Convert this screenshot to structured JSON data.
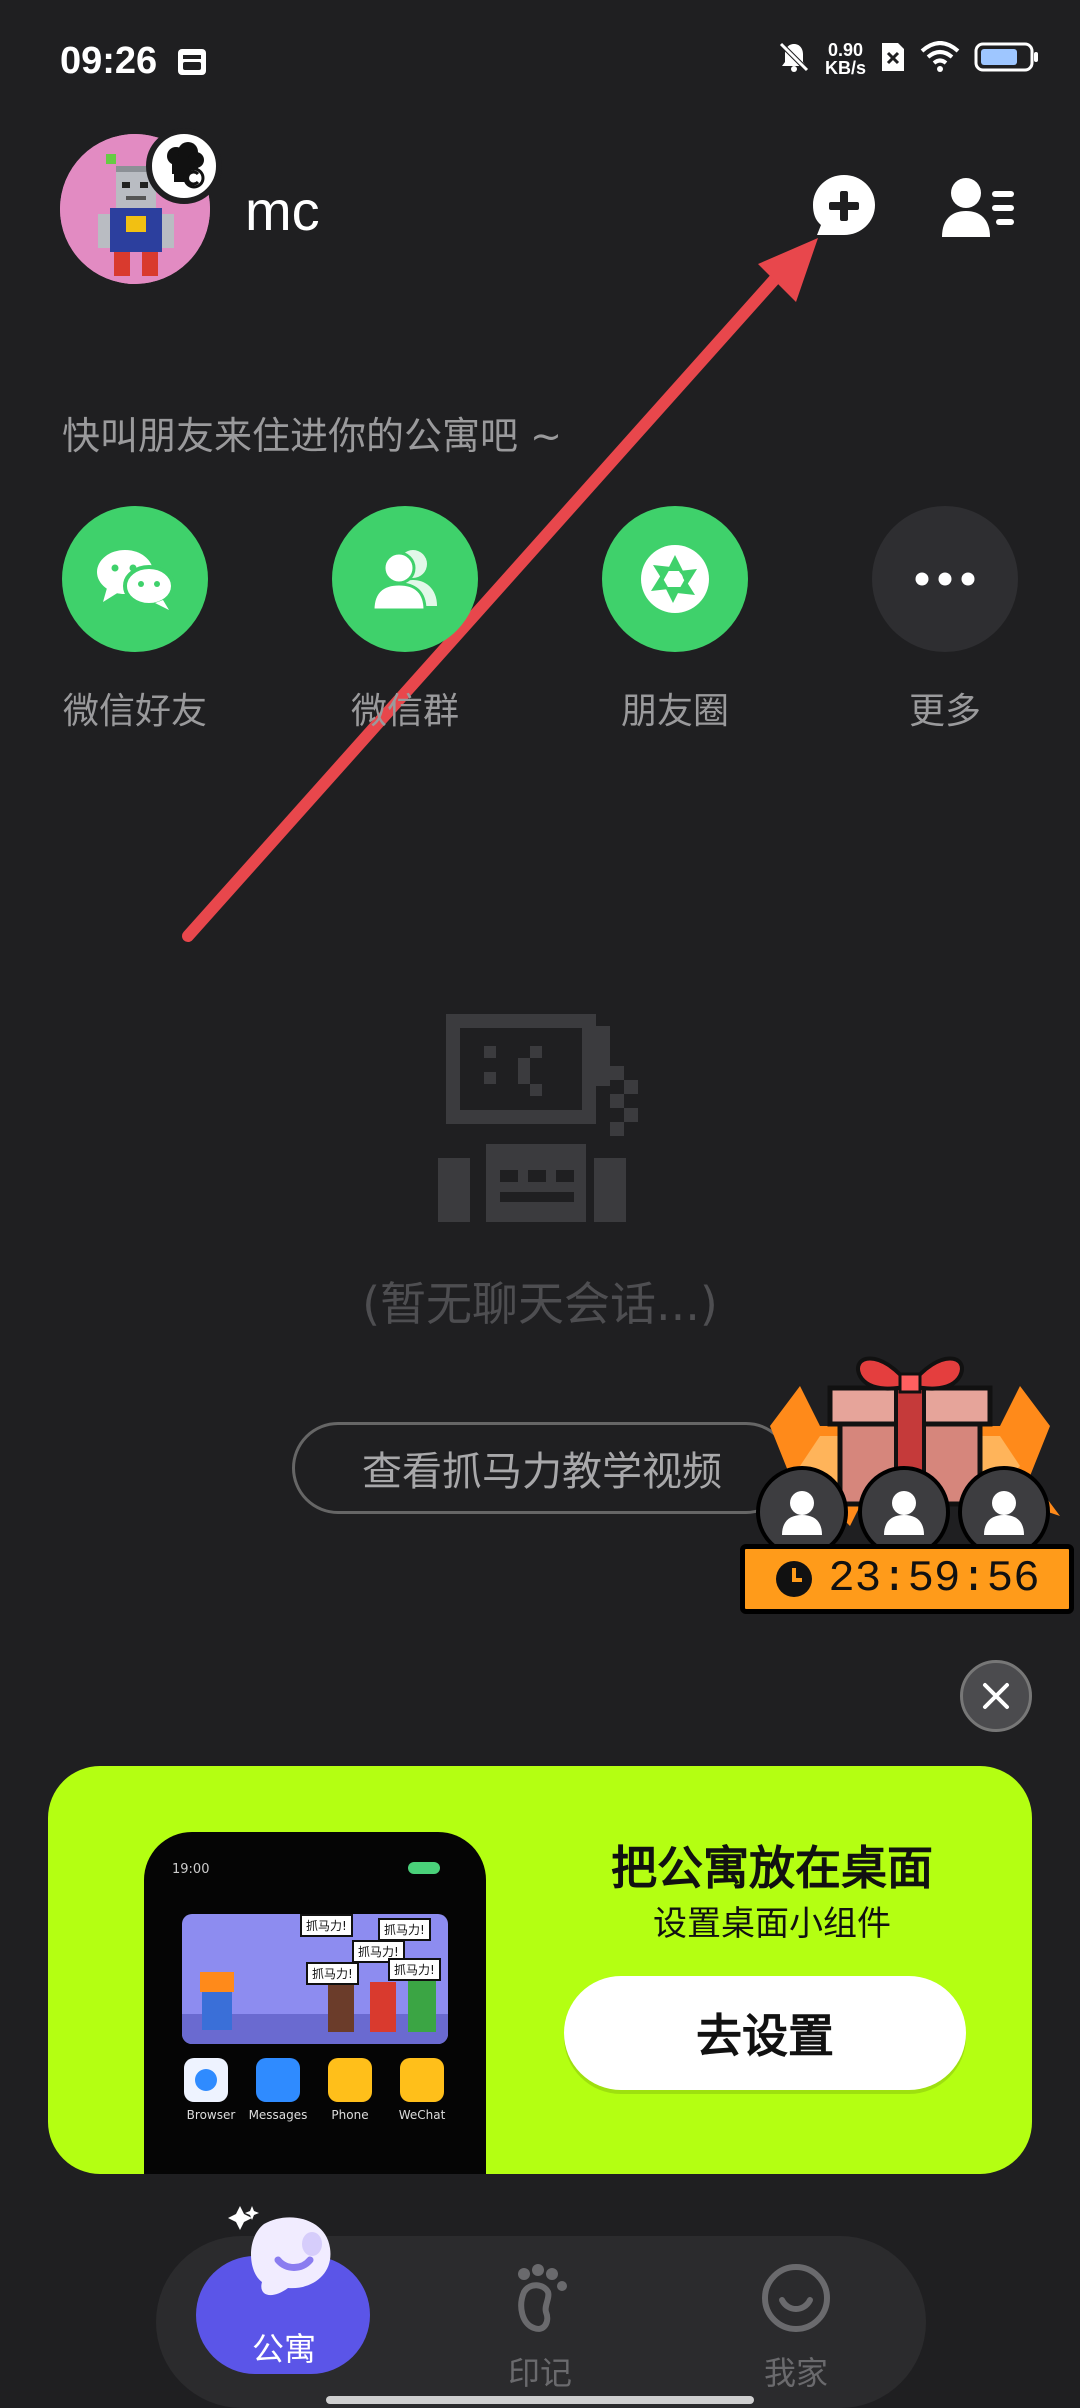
{
  "status_bar": {
    "time": "09:26",
    "net_speed_value": "0.90",
    "net_speed_unit": "KB/s"
  },
  "header": {
    "username": "mc"
  },
  "invite": {
    "prompt": "快叫朋友来住进你的公寓吧 ~",
    "options": [
      {
        "label": "微信好友",
        "icon": "wechat-chat-icon"
      },
      {
        "label": "微信群",
        "icon": "wechat-group-icon"
      },
      {
        "label": "朋友圈",
        "icon": "moments-icon"
      },
      {
        "label": "更多",
        "icon": "more-dots-icon"
      }
    ]
  },
  "empty_state": {
    "message": "(暂无聊天会话...)",
    "tutorial_button": "查看抓马力教学视频"
  },
  "gift": {
    "countdown": "23:59:56"
  },
  "widget_banner": {
    "title": "把公寓放在桌面",
    "subtitle": "设置桌面小组件",
    "button": "去设置",
    "preview": {
      "time": "19:00",
      "bubbles": [
        "抓马力!",
        "抓马力!",
        "抓马力!",
        "抓马力!",
        "抓马力!"
      ],
      "apps": [
        "Browser",
        "Messages",
        "Phone",
        "WeChat"
      ]
    }
  },
  "bottom_nav": {
    "items": [
      {
        "label": "公寓",
        "active": true
      },
      {
        "label": "印记",
        "active": false
      },
      {
        "label": "我家",
        "active": false
      }
    ]
  },
  "colors": {
    "background": "#1f1f21",
    "wechat_green": "#3fd16b",
    "banner_lime": "#b4ff12",
    "nav_active": "#5b55e8",
    "arrow_red": "#e8474c",
    "timer_orange": "#ff9b1a"
  }
}
